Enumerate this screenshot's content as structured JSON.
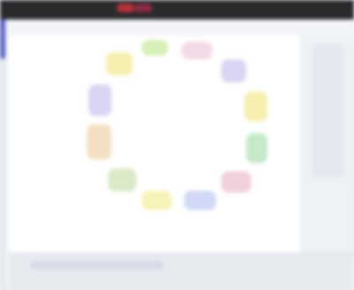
{
  "colors": {
    "topbar": "#2a2a2c",
    "accent_blue": "#5c63c8",
    "segments": [
      "#d7f0b8",
      "#d9d5f3",
      "#c6e9c9",
      "#f3e0c3",
      "#f6efb0",
      "#d0d8f6",
      "#f0d0dc",
      "#cfe6f6",
      "#f7f2b7",
      "#dbe9c8",
      "#d9d5f3"
    ]
  },
  "caption": {
    "text": ""
  },
  "icons": {}
}
